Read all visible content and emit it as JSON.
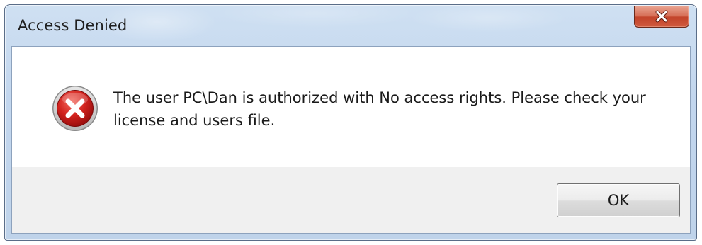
{
  "window": {
    "title": "Access Denied"
  },
  "titlebar": {
    "close_icon": "close-icon"
  },
  "dialog": {
    "icon": "error-icon",
    "message": "The user PC\\Dan is authorized with No access rights. Please check your license and users file.",
    "ok_label": "OK"
  },
  "colors": {
    "titlebar": "#c2d6ee",
    "close_button": "#c2432a",
    "error_icon": "#c8161d",
    "button_area": "#f0f0f0"
  }
}
